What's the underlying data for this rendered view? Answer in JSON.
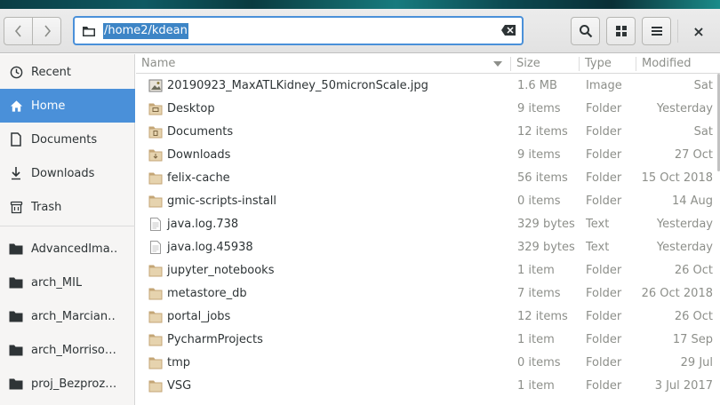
{
  "window": {
    "location_path": "/home2/kdean"
  },
  "header": {
    "buttons": {
      "back_icon": "chevron-left-icon",
      "forward_icon": "chevron-right-icon",
      "search_icon": "search-icon",
      "view_icon": "grid-icon",
      "menu_icon": "hamburger-icon",
      "close_label": "×"
    }
  },
  "sidebar": {
    "items": [
      {
        "label": "Recent",
        "icon": "clock-icon"
      },
      {
        "label": "Home",
        "icon": "home-icon",
        "selected": true
      },
      {
        "label": "Documents",
        "icon": "document-icon"
      },
      {
        "label": "Downloads",
        "icon": "download-icon"
      },
      {
        "label": "Trash",
        "icon": "trash-icon"
      }
    ],
    "bookmarks": [
      {
        "label": "AdvancedIma…",
        "icon": "folder-icon"
      },
      {
        "label": "arch_MIL",
        "icon": "folder-icon"
      },
      {
        "label": "arch_Marcian…",
        "icon": "folder-icon"
      },
      {
        "label": "arch_Morriso…",
        "icon": "folder-icon"
      },
      {
        "label": "proj_Bezproz…",
        "icon": "folder-icon"
      }
    ]
  },
  "columns": {
    "name": "Name",
    "size": "Size",
    "type": "Type",
    "modified": "Modified"
  },
  "files": [
    {
      "name": "20190923_MaxATLKidney_50micronScale.jpg",
      "size": "1.6 MB",
      "type": "Image",
      "modified": "Sat",
      "icon": "image-file-icon"
    },
    {
      "name": "Desktop",
      "size": "9 items",
      "type": "Folder",
      "modified": "Yesterday",
      "icon": "desktop-folder-icon"
    },
    {
      "name": "Documents",
      "size": "12 items",
      "type": "Folder",
      "modified": "Sat",
      "icon": "documents-folder-icon"
    },
    {
      "name": "Downloads",
      "size": "9 items",
      "type": "Folder",
      "modified": "27 Oct",
      "icon": "downloads-folder-icon"
    },
    {
      "name": "felix-cache",
      "size": "56 items",
      "type": "Folder",
      "modified": "15 Oct 2018",
      "icon": "folder-icon"
    },
    {
      "name": "gmic-scripts-install",
      "size": "0 items",
      "type": "Folder",
      "modified": "14 Aug",
      "icon": "folder-icon"
    },
    {
      "name": "java.log.738",
      "size": "329 bytes",
      "type": "Text",
      "modified": "Yesterday",
      "icon": "text-file-icon"
    },
    {
      "name": "java.log.45938",
      "size": "329 bytes",
      "type": "Text",
      "modified": "Yesterday",
      "icon": "text-file-icon"
    },
    {
      "name": "jupyter_notebooks",
      "size": "1 item",
      "type": "Folder",
      "modified": "26 Oct",
      "icon": "folder-icon"
    },
    {
      "name": "metastore_db",
      "size": "7 items",
      "type": "Folder",
      "modified": "26 Oct 2018",
      "icon": "folder-icon"
    },
    {
      "name": "portal_jobs",
      "size": "12 items",
      "type": "Folder",
      "modified": "26 Oct",
      "icon": "folder-icon"
    },
    {
      "name": "PycharmProjects",
      "size": "1 item",
      "type": "Folder",
      "modified": "17 Sep",
      "icon": "folder-icon"
    },
    {
      "name": "tmp",
      "size": "0 items",
      "type": "Folder",
      "modified": "29 Jul",
      "icon": "folder-icon"
    },
    {
      "name": "VSG",
      "size": "1 item",
      "type": "Folder",
      "modified": "3 Jul 2017",
      "icon": "folder-icon"
    }
  ],
  "colors": {
    "accent": "#4a90d9",
    "selection_text": "#3d85c6",
    "folder": "#c4a676"
  }
}
